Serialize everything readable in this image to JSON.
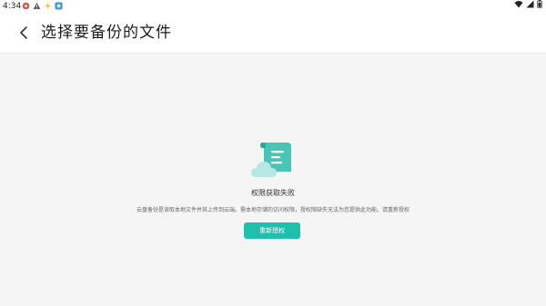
{
  "status_bar": {
    "time": "4:34",
    "icons_left": [
      "weibo-like-icon",
      "warning-icon",
      "sun-icon",
      "app-icon"
    ],
    "icons_right": [
      "wifi-icon",
      "signal-icon",
      "battery-icon"
    ]
  },
  "app_bar": {
    "back_icon": "chevron-left-icon",
    "title": "选择要备份的文件"
  },
  "empty_state": {
    "illustration": "cloud-document-icon",
    "title": "权限获取失败",
    "description": "云盘备份是读取本地文件并其上传到云端。需本地存储的访问权限，授权限缺失无法为您提供此功能。请重新授权",
    "button_label": "重新授权"
  },
  "colors": {
    "accent": "#1fbfae",
    "background": "#f5f5f5",
    "appbar": "#ffffff"
  }
}
